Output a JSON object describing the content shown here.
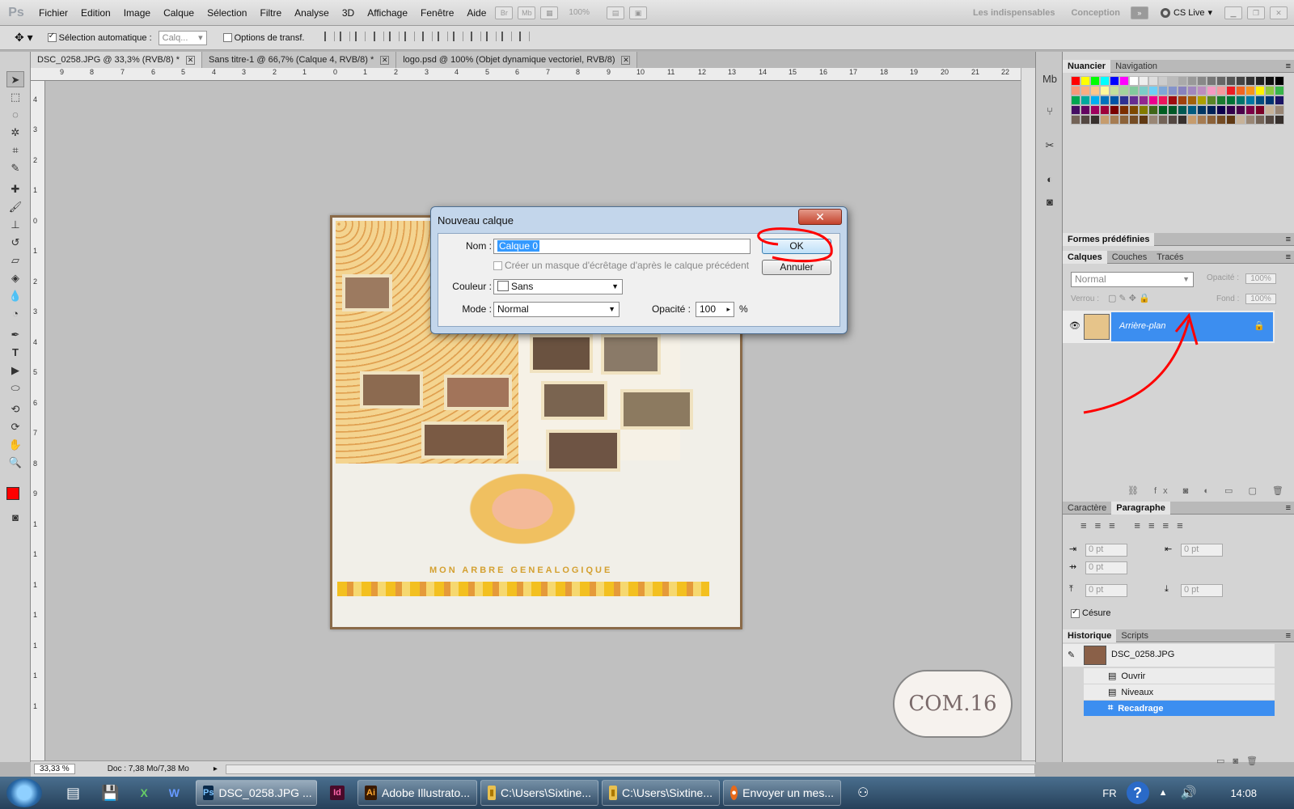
{
  "menubar": {
    "logo": "Ps",
    "items": [
      "Fichier",
      "Edition",
      "Image",
      "Calque",
      "Sélection",
      "Filtre",
      "Analyse",
      "3D",
      "Affichage",
      "Fenêtre",
      "Aide"
    ],
    "zoom": "100%",
    "workspace1": "Les indispensables",
    "workspace2": "Conception",
    "cslive": "CS Live"
  },
  "options": {
    "auto_select": "Sélection automatique :",
    "auto_select_value": "Calq...",
    "transform": "Options de transf."
  },
  "tabs": [
    {
      "label": "DSC_0258.JPG @ 33,3% (RVB/8) *"
    },
    {
      "label": "Sans titre-1 @ 66,7% (Calque 4, RVB/8) *"
    },
    {
      "label": "logo.psd @ 100% (Objet dynamique vectoriel, RVB/8)"
    }
  ],
  "ruler_top": [
    "9",
    "8",
    "7",
    "6",
    "5",
    "4",
    "3",
    "2",
    "1",
    "0",
    "1",
    "2",
    "3",
    "4",
    "5",
    "6",
    "7",
    "8",
    "9",
    "10",
    "11",
    "12",
    "13",
    "14",
    "15",
    "16",
    "17",
    "18",
    "19",
    "20",
    "21",
    "22"
  ],
  "ruler_left": [
    "4",
    "3",
    "2",
    "1",
    "0",
    "1",
    "2",
    "3",
    "4",
    "5",
    "6",
    "7",
    "8",
    "9",
    "1",
    "1",
    "1",
    "1",
    "1",
    "1",
    "1"
  ],
  "status": {
    "zoom": "33,33 %",
    "doc": "Doc : 7,38 Mo/7,38 Mo"
  },
  "canvas": {
    "photo_caption": "MON ARBRE GENEALOGIQUE",
    "watermark": "COM.16"
  },
  "dialog": {
    "title": "Nouveau calque",
    "name_label": "Nom :",
    "name_value": "Calque 0",
    "clip_label": "Créer un masque d'écrêtage d'après le calque précédent",
    "color_label": "Couleur :",
    "color_value": "Sans",
    "mode_label": "Mode :",
    "mode_value": "Normal",
    "opacity_label": "Opacité :",
    "opacity_value": "100",
    "opacity_unit": "%",
    "ok": "OK",
    "cancel": "Annuler"
  },
  "panels": {
    "swatches_tabs": [
      "Nuancier",
      "Navigation"
    ],
    "presets_title": "Formes prédéfinies",
    "layers_tabs": [
      "Calques",
      "Couches",
      "Tracés"
    ],
    "blend_mode": "Normal",
    "opacity_label": "Opacité :",
    "opacity_value": "100%",
    "lock_label": "Verrou :",
    "fill_label": "Fond :",
    "fill_value": "100%",
    "layer_name": "Arrière-plan",
    "char_tabs": [
      "Caractère",
      "Paragraphe"
    ],
    "indent_values": [
      "0 pt",
      "0 pt",
      "0 pt",
      "0 pt",
      "0 pt"
    ],
    "hyphen_label": "Césure",
    "history_tabs": [
      "Historique",
      "Scripts"
    ],
    "history_snapshot": "DSC_0258.JPG",
    "history_items": [
      "Ouvrir",
      "Niveaux",
      "Recadrage"
    ]
  },
  "taskbar": {
    "items": [
      "DSC_0258.JPG ...",
      "Adobe Illustrato...",
      "C:\\Users\\Sixtine...",
      "C:\\Users\\Sixtine...",
      "Envoyer un mes..."
    ],
    "lang": "FR",
    "time": "14:08"
  },
  "colors": {
    "accent": "#3399ff",
    "selection": "#3c8ef0",
    "annotation": "#ff0000"
  }
}
